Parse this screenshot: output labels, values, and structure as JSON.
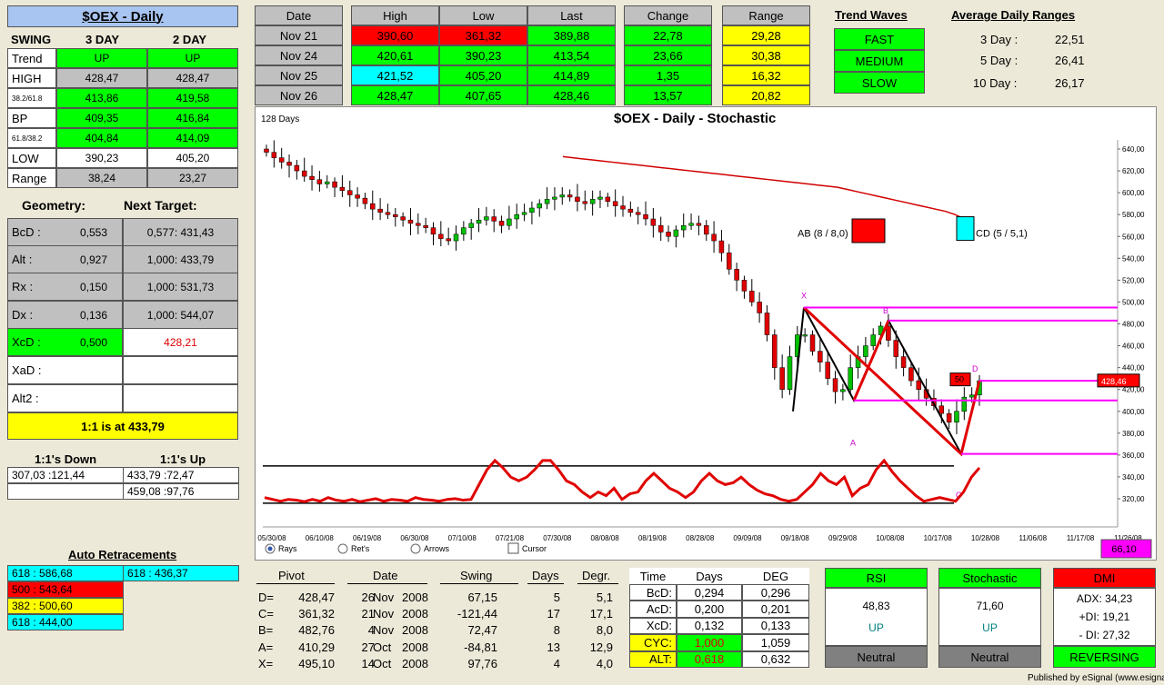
{
  "title": "$OEX - Daily",
  "swing": {
    "label": "SWING",
    "col1": "3 DAY",
    "col2": "2 DAY"
  },
  "swing_rows": [
    {
      "label": "Trend",
      "v1": "UP",
      "v2": "UP"
    },
    {
      "label": "HIGH",
      "v1": "428,47",
      "v2": "428,47"
    },
    {
      "label": "38.2/61.8",
      "v1": "413,86",
      "v2": "419,58"
    },
    {
      "label": "BP",
      "v1": "409,35",
      "v2": "416,84"
    },
    {
      "label": "61.8/38.2",
      "v1": "404,84",
      "v2": "414,09"
    },
    {
      "label": "LOW",
      "v1": "390,23",
      "v2": "405,20"
    },
    {
      "label": "Range",
      "v1": "38,24",
      "v2": "23,27"
    }
  ],
  "geometry": {
    "label": "Geometry:",
    "target": "Next Target:"
  },
  "geo_rows": [
    {
      "label": "BcD   :",
      "v": "0,553",
      "t": "0,577: 431,43"
    },
    {
      "label": "Alt     :",
      "v": "0,927",
      "t": "1,000: 433,79"
    },
    {
      "label": "Rx     :",
      "v": "0,150",
      "t": "1,000: 531,73"
    },
    {
      "label": "Dx     :",
      "v": "0,136",
      "t": "1,000: 544,07"
    },
    {
      "label": "XcD   :",
      "v": "0,500",
      "t": "428,21"
    },
    {
      "label": "XaD   :",
      "v": "",
      "t": ""
    },
    {
      "label": "Alt2   :",
      "v": "",
      "t": ""
    }
  ],
  "one_to_one": "1:1 is at 433,79",
  "ones_down_label": "1:1's Down",
  "ones_up_label": "1:1's Up",
  "ones_down": [
    "307,03 :121,44",
    ""
  ],
  "ones_up": [
    "433,79 :72,47",
    "459,08 :97,76"
  ],
  "auto_retr_label": "Auto Retracements",
  "auto_retr_left": [
    "618 : 586,68",
    "500 : 543,64",
    "382 : 500,60",
    "618 : 444,00"
  ],
  "auto_retr_right": [
    "618 : 436,37"
  ],
  "price_table": {
    "headers": [
      "Date",
      "High",
      "Low",
      "Last",
      "Change",
      "Range"
    ],
    "rows": [
      {
        "date": "Nov  21",
        "high": "390,60",
        "low": "361,32",
        "last": "389,88",
        "change": "22,78",
        "range": "29,28"
      },
      {
        "date": "Nov  24",
        "high": "420,61",
        "low": "390,23",
        "last": "413,54",
        "change": "23,66",
        "range": "30,38"
      },
      {
        "date": "Nov  25",
        "high": "421,52",
        "low": "405,20",
        "last": "414,89",
        "change": "1,35",
        "range": "16,32"
      },
      {
        "date": "Nov  26",
        "high": "428,47",
        "low": "407,65",
        "last": "428,46",
        "change": "13,57",
        "range": "20,82"
      }
    ]
  },
  "trend_waves": {
    "label": "Trend Waves",
    "items": [
      "FAST",
      "MEDIUM",
      "SLOW"
    ]
  },
  "avg_ranges": {
    "label": "Average Daily Ranges",
    "rows": [
      {
        "k": "3 Day :",
        "v": "22,51"
      },
      {
        "k": "5 Day :",
        "v": "26,41"
      },
      {
        "k": "10 Day :",
        "v": "26,17"
      }
    ]
  },
  "chart": {
    "days_label": "128 Days",
    "title": "$OEX - Daily - Stochastic",
    "ab_label": "AB (8 / 8,0)",
    "cd_label": "CD (5 / 5,1)",
    "box_50": "50",
    "price_tag": "428,46",
    "stoch_value": "66,10",
    "pt_labels": {
      "x": "X",
      "a": "A",
      "b": "B",
      "c": "C",
      "d": "D"
    },
    "x_labels": [
      "05/30/08",
      "06/10/08",
      "06/19/08",
      "06/30/08",
      "07/10/08",
      "07/21/08",
      "07/30/08",
      "08/08/08",
      "08/19/08",
      "08/28/08",
      "09/09/08",
      "09/18/08",
      "09/29/08",
      "10/08/08",
      "10/17/08",
      "10/28/08",
      "11/06/08",
      "11/17/08",
      "11/26/08"
    ],
    "y_labels": [
      "640,00",
      "620,00",
      "600,00",
      "580,00",
      "560,00",
      "540,00",
      "520,00",
      "500,00",
      "480,00",
      "460,00",
      "440,00",
      "420,00",
      "400,00",
      "380,00",
      "360,00",
      "340,00",
      "320,00"
    ],
    "radios": [
      "Rays",
      "Ret's",
      "Arrows"
    ],
    "cursor": "Cursor"
  },
  "chart_data": {
    "type": "line",
    "title": "$OEX - Daily - Stochastic",
    "ylim": [
      310,
      650
    ],
    "series": [
      {
        "name": "",
        "values": [
          637,
          632,
          628,
          625,
          620,
          615,
          612,
          608,
          610,
          605,
          602,
          598,
          595,
          590,
          585,
          582,
          580,
          578,
          575,
          572,
          570,
          568,
          562,
          558,
          556,
          562,
          568,
          572,
          575,
          578,
          574,
          570,
          576,
          580,
          582,
          586,
          590,
          594,
          596,
          598,
          596,
          592,
          590,
          594,
          596,
          592,
          588,
          585,
          582,
          580,
          576,
          570,
          564,
          560,
          566,
          570,
          572,
          570,
          562,
          556,
          545,
          530,
          520,
          510,
          500,
          490,
          470,
          440,
          420,
          450,
          470,
          470,
          455,
          445,
          430,
          418,
          420,
          440,
          450,
          460,
          470,
          478,
          465,
          450,
          440,
          428,
          420,
          412,
          405,
          398,
          390,
          400,
          413,
          415,
          428
        ]
      },
      {
        "name": "",
        "values": [
          633,
          632,
          631,
          630,
          629,
          628,
          627,
          626,
          625,
          624,
          623,
          622,
          621,
          620,
          619,
          618,
          617,
          616,
          615,
          614,
          613,
          612,
          611,
          610,
          609,
          608,
          607,
          606,
          605,
          603,
          601,
          599,
          597,
          595,
          593,
          591,
          589,
          587,
          585,
          583,
          580,
          576
        ]
      }
    ]
  },
  "pivot_table": {
    "headers": [
      "Pivot",
      "Date",
      "Swing",
      "Days",
      "Degr."
    ],
    "rows": [
      {
        "p": "D=",
        "pv": "428,47",
        "d": "26",
        "m": "Nov",
        "y": "2008",
        "s": "67,15",
        "days": "5",
        "deg": "5,1"
      },
      {
        "p": "C=",
        "pv": "361,32",
        "d": "21",
        "m": "Nov",
        "y": "2008",
        "s": "-121,44",
        "days": "17",
        "deg": "17,1"
      },
      {
        "p": "B=",
        "pv": "482,76",
        "d": "4",
        "m": "Nov",
        "y": "2008",
        "s": "72,47",
        "days": "8",
        "deg": "8,0"
      },
      {
        "p": "A=",
        "pv": "410,29",
        "d": "27",
        "m": "Oct",
        "y": "2008",
        "s": "-84,81",
        "days": "13",
        "deg": "12,9"
      },
      {
        "p": "X=",
        "pv": "495,10",
        "d": "14",
        "m": "Oct",
        "y": "2008",
        "s": "97,76",
        "days": "4",
        "deg": "4,0"
      }
    ]
  },
  "time_table": {
    "headers": [
      "Time",
      "Days",
      "DEG"
    ],
    "rows": [
      {
        "k": "BcD:",
        "d": "0,294",
        "g": "0,296"
      },
      {
        "k": "AcD:",
        "d": "0,200",
        "g": "0,201"
      },
      {
        "k": "XcD:",
        "d": "0,132",
        "g": "0,133"
      },
      {
        "k": "CYC:",
        "d": "1,000",
        "g": "1,059"
      },
      {
        "k": "ALT:",
        "d": "0,618",
        "g": "0,632"
      }
    ]
  },
  "rsi": {
    "label": "RSI",
    "value": "48,83",
    "dir": "UP",
    "status": "Neutral"
  },
  "stochastic": {
    "label": "Stochastic",
    "value": "71,60",
    "dir": "UP",
    "status": "Neutral"
  },
  "dmi": {
    "label": "DMI",
    "adx": "ADX:  34,23",
    "pdi": "+DI:  19,21",
    "mdi": "- DI:  27,32",
    "status": "REVERSING"
  },
  "footer": "Published by eSignal (www.esignal.com)",
  "colors": {
    "up": "#00ff00",
    "down": "#ff0000",
    "highlight": "#ffff00",
    "cyan": "#00ffff",
    "magenta": "#ff00ff"
  }
}
